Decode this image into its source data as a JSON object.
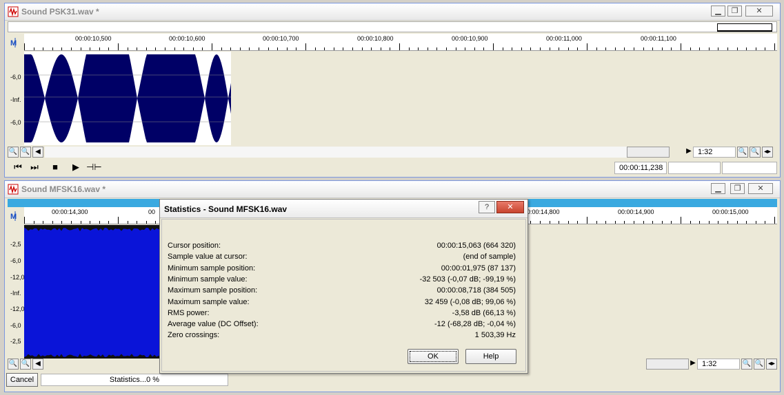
{
  "window1": {
    "title": "Sound PSK31.wav *",
    "ruler": [
      "00:00:10,500",
      "00:00:10,600",
      "00:00:10,700",
      "00:00:10,800",
      "00:00:10,900",
      "00:00:11,000",
      "00:00:11,100"
    ],
    "db_labels": [
      "-6,0",
      "-Inf.",
      "-6,0"
    ],
    "zoom": "1:32",
    "position": "00:00:11,238"
  },
  "window2": {
    "title": "Sound MFSK16.wav *",
    "ruler": [
      "00:00:14,300",
      "00",
      "00:00:14,800",
      "00:00:14,900",
      "00:00:15,000"
    ],
    "db_labels": [
      "-2,5",
      "-6,0",
      "-12,0",
      "-Inf.",
      "-12,0",
      "-6,0",
      "-2,5"
    ],
    "zoom": "1:32"
  },
  "status": {
    "cancel_label": "Cancel",
    "progress_text": "Statistics...0 %"
  },
  "dialog": {
    "title": "Statistics - Sound MFSK16.wav",
    "rows": [
      {
        "label": "Cursor position:",
        "value": "00:00:15,063  (664 320)"
      },
      {
        "label": "Sample value at cursor:",
        "value": "(end of sample)"
      },
      {
        "label": "Minimum sample position:",
        "value": "00:00:01,975  (87 137)"
      },
      {
        "label": "Minimum sample value:",
        "value": "-32 503 (-0,07 dB; -99,19 %)"
      },
      {
        "label": "Maximum sample position:",
        "value": "00:00:08,718  (384 505)"
      },
      {
        "label": "Maximum sample value:",
        "value": "32 459 (-0,08 dB; 99,06 %)"
      },
      {
        "label": "RMS power:",
        "value": "-3,58 dB (66,13 %)"
      },
      {
        "label": "Average value (DC Offset):",
        "value": "-12 (-68,28 dB; -0,04 %)"
      },
      {
        "label": "Zero crossings:",
        "value": "1 503,39 Hz"
      }
    ],
    "ok_label": "OK",
    "help_label": "Help"
  },
  "colors": {
    "wave_psk": "#000066",
    "wave_mfsk": "#0a14d8",
    "selection_bar": "#3aa9e0"
  }
}
